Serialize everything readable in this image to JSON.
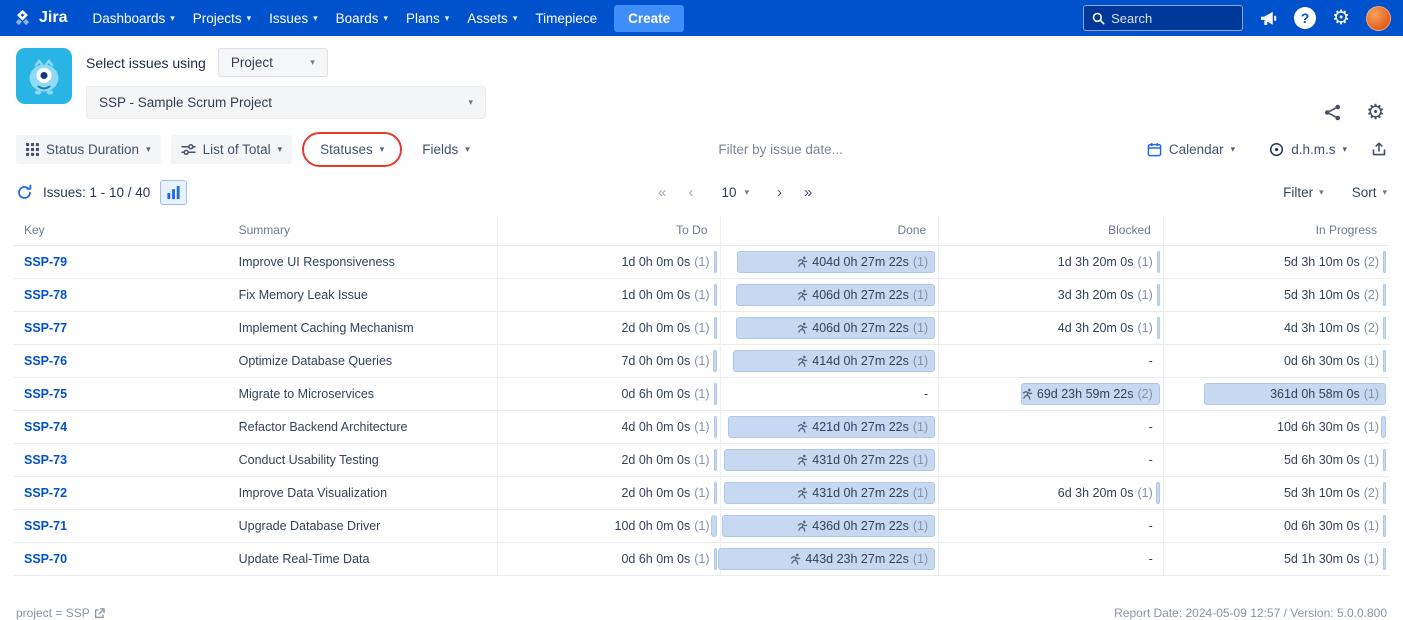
{
  "nav": {
    "brand": "Jira",
    "items": [
      {
        "label": "Dashboards"
      },
      {
        "label": "Projects"
      },
      {
        "label": "Issues"
      },
      {
        "label": "Boards"
      },
      {
        "label": "Plans"
      },
      {
        "label": "Assets"
      },
      {
        "label": "Timepiece"
      }
    ],
    "create_label": "Create",
    "search_placeholder": "Search"
  },
  "header": {
    "select_label": "Select issues using",
    "mode_value": "Project",
    "project_value": "SSP - Sample Scrum Project"
  },
  "toolbar": {
    "report_type": "Status Duration",
    "view": "List of Total",
    "statuses": "Statuses",
    "fields": "Fields",
    "date_filter_placeholder": "Filter by issue date...",
    "calendar": "Calendar",
    "format": "d.h.m.s"
  },
  "pagination": {
    "issues_label": "Issues: 1 - 10 / 40",
    "first": "«",
    "prev": "‹",
    "page_size": "10",
    "next": "›",
    "last": "»",
    "filter_label": "Filter",
    "sort_label": "Sort"
  },
  "table": {
    "columns": [
      "Key",
      "Summary",
      "To Do",
      "Done",
      "Blocked",
      "In Progress"
    ],
    "rows": [
      {
        "key": "SSP-79",
        "summary": "Improve UI Responsiveness",
        "todo": {
          "t": "1d 0h 0m 0s",
          "c": "(1)",
          "b": 0.8
        },
        "done": {
          "t": "404d 0h 27m 22s",
          "c": "(1)",
          "b": 91,
          "r": true
        },
        "blocked": {
          "t": "1d 3h 20m 0s",
          "c": "(1)",
          "b": 0.8
        },
        "inprogress": {
          "t": "5d 3h 10m 0s",
          "c": "(2)",
          "b": 1.3
        }
      },
      {
        "key": "SSP-78",
        "summary": "Fix Memory Leak Issue",
        "todo": {
          "t": "1d 0h 0m 0s",
          "c": "(1)",
          "b": 0.8
        },
        "done": {
          "t": "406d 0h 27m 22s",
          "c": "(1)",
          "b": 91.5,
          "r": true
        },
        "blocked": {
          "t": "3d 3h 20m 0s",
          "c": "(1)",
          "b": 1
        },
        "inprogress": {
          "t": "5d 3h 10m 0s",
          "c": "(2)",
          "b": 1.3
        }
      },
      {
        "key": "SSP-77",
        "summary": "Implement Caching Mechanism",
        "todo": {
          "t": "2d 0h 0m 0s",
          "c": "(1)",
          "b": 1
        },
        "done": {
          "t": "406d 0h 27m 22s",
          "c": "(1)",
          "b": 91.5,
          "r": true
        },
        "blocked": {
          "t": "4d 3h 20m 0s",
          "c": "(1)",
          "b": 1.2
        },
        "inprogress": {
          "t": "4d 3h 10m 0s",
          "c": "(2)",
          "b": 1.2
        }
      },
      {
        "key": "SSP-76",
        "summary": "Optimize Database Queries",
        "todo": {
          "t": "7d 0h 0m 0s",
          "c": "(1)",
          "b": 1.8
        },
        "done": {
          "t": "414d 0h 27m 22s",
          "c": "(1)",
          "b": 93,
          "r": true
        },
        "blocked": {
          "t": "-"
        },
        "inprogress": {
          "t": "0d 6h 30m 0s",
          "c": "(1)",
          "b": 0.5
        }
      },
      {
        "key": "SSP-75",
        "summary": "Migrate to Microservices",
        "todo": {
          "t": "0d 6h 0m 0s",
          "c": "(1)",
          "b": 0.5
        },
        "done": {
          "t": "-"
        },
        "blocked": {
          "t": "69d 23h 59m 22s",
          "c": "(2)",
          "b": 62,
          "r": true
        },
        "inprogress": {
          "t": "361d 0h 58m 0s",
          "c": "(1)",
          "b": 81
        }
      },
      {
        "key": "SSP-74",
        "summary": "Refactor Backend Architecture",
        "todo": {
          "t": "4d 0h 0m 0s",
          "c": "(1)",
          "b": 1.3
        },
        "done": {
          "t": "421d 0h 27m 22s",
          "c": "(1)",
          "b": 95,
          "r": true
        },
        "blocked": {
          "t": "-"
        },
        "inprogress": {
          "t": "10d 6h 30m 0s",
          "c": "(1)",
          "b": 2.4
        }
      },
      {
        "key": "SSP-73",
        "summary": "Conduct Usability Testing",
        "todo": {
          "t": "2d 0h 0m 0s",
          "c": "(1)",
          "b": 1
        },
        "done": {
          "t": "431d 0h 27m 22s",
          "c": "(1)",
          "b": 97,
          "r": true
        },
        "blocked": {
          "t": "-"
        },
        "inprogress": {
          "t": "5d 6h 30m 0s",
          "c": "(1)",
          "b": 1.3
        }
      },
      {
        "key": "SSP-72",
        "summary": "Improve Data Visualization",
        "todo": {
          "t": "2d 0h 0m 0s",
          "c": "(1)",
          "b": 1
        },
        "done": {
          "t": "431d 0h 27m 22s",
          "c": "(1)",
          "b": 97,
          "r": true
        },
        "blocked": {
          "t": "6d 3h 20m 0s",
          "c": "(1)",
          "b": 1.5
        },
        "inprogress": {
          "t": "5d 3h 10m 0s",
          "c": "(2)",
          "b": 1.3
        }
      },
      {
        "key": "SSP-71",
        "summary": "Upgrade Database Driver",
        "todo": {
          "t": "10d 0h 0m 0s",
          "c": "(1)",
          "b": 2.4
        },
        "done": {
          "t": "436d 0h 27m 22s",
          "c": "(1)",
          "b": 98,
          "r": true
        },
        "blocked": {
          "t": "-"
        },
        "inprogress": {
          "t": "0d 6h 30m 0s",
          "c": "(1)",
          "b": 0.5
        }
      },
      {
        "key": "SSP-70",
        "summary": "Update Real-Time Data",
        "todo": {
          "t": "0d 6h 0m 0s",
          "c": "(1)",
          "b": 0.5
        },
        "done": {
          "t": "443d 23h 27m 22s",
          "c": "(1)",
          "b": 100,
          "r": true
        },
        "blocked": {
          "t": "-"
        },
        "inprogress": {
          "t": "5d 1h 30m 0s",
          "c": "(1)",
          "b": 1.3
        }
      }
    ]
  },
  "footer": {
    "query": "project = SSP",
    "report_info": "Report Date: 2024-05-09 12:57 / Version: 5.0.0.800"
  }
}
